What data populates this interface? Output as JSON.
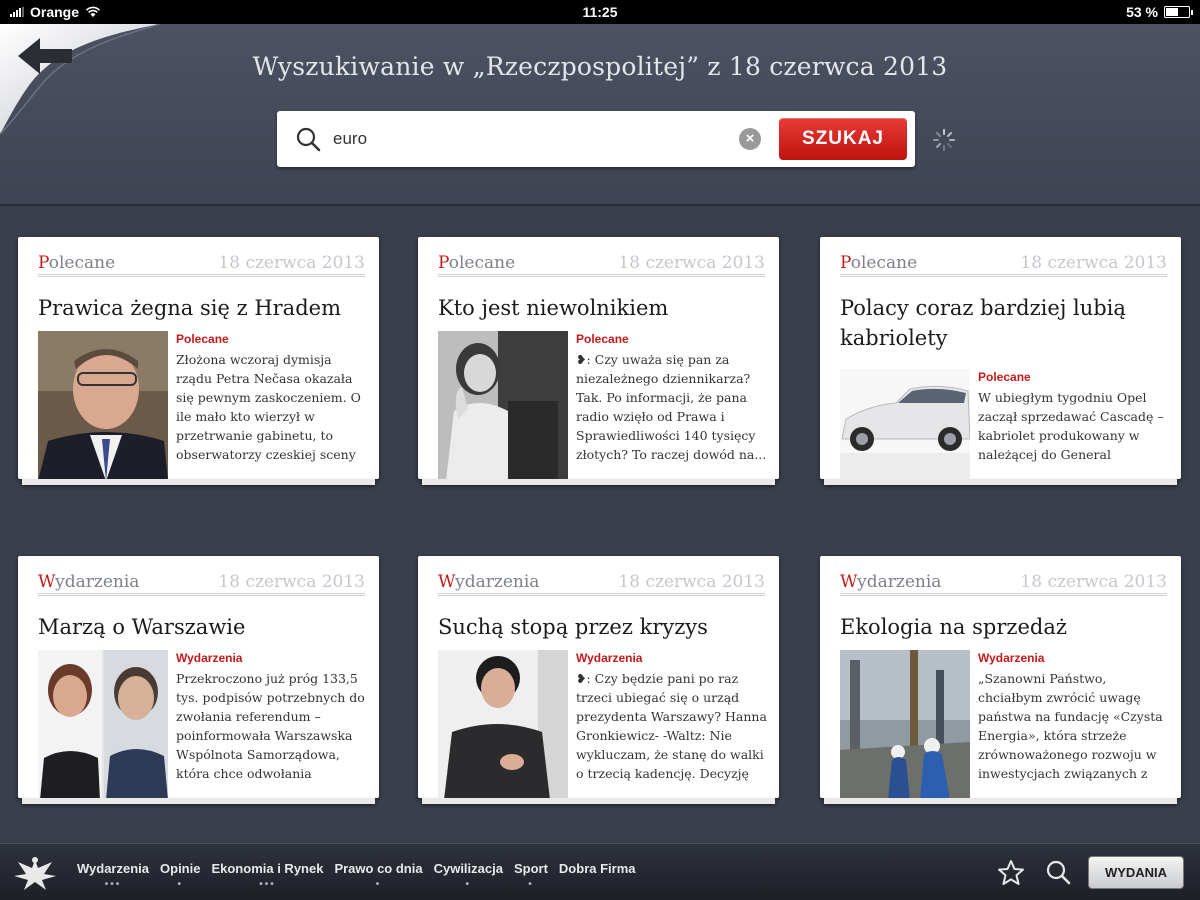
{
  "status_bar": {
    "carrier": "Orange",
    "time": "11:25",
    "battery": "53 %",
    "battery_level": 0.53
  },
  "header": {
    "title": "Wyszukiwanie w „Rzeczpospolitej” z 18 czerwca 2013",
    "back_icon": "back-arrow-icon"
  },
  "search": {
    "value": "euro",
    "button_label": "SZUKAJ"
  },
  "cards": [
    {
      "category": "Polecane",
      "date": "18 czerwca 2013",
      "title": "Prawica żegna się z Hradem",
      "tag": "Polecane",
      "excerpt": "Złożona wczoraj dymisja rządu Petra Nečasa okazała się pewnym zaskoczeniem. O ile mało kto wierzył w przetrwanie gabinetu, to obserwatorzy czeskiej sceny politycznej spod..."
    },
    {
      "category": "Polecane",
      "date": "18 czerwca 2013",
      "title": "Kto jest niewolnikiem",
      "tag": "Polecane",
      "excerpt": "❥: Czy uważa się pan za niezależnego dziennikarza? Tak. Po informacji, że pana radio wzięło od Prawa i Sprawiedliwości 140 tysięcy złotych? To raczej dowód na..."
    },
    {
      "category": "Polecane",
      "date": "18 czerwca 2013",
      "title": "Polacy coraz bardziej lubią kabriolety",
      "tag": "Polecane",
      "excerpt": "W ubiegłym tygodniu Opel zaczął sprzedawać Cascadę – kabriolet produkowany w należącej do General Motors..."
    },
    {
      "category": "Wydarzenia",
      "date": "18 czerwca 2013",
      "title": "Marzą o Warszawie",
      "tag": "Wydarzenia",
      "excerpt": "Przekroczono już próg 133,5 tys. podpisów potrzebnych do zwołania referendum – poinformowała Warszawska Wspólnota Samorządowa, która chce odwołania prezyde..."
    },
    {
      "category": "Wydarzenia",
      "date": "18 czerwca 2013",
      "title": "Suchą stopą przez kryzys",
      "tag": "Wydarzenia",
      "excerpt": "❥: Czy będzie pani po raz trzeci ubiegać się o urząd prezydenta Warszawy? Hanna Gronkiewicz- -Waltz: Nie wykluczam, że stanę do walki o trzecią kadencję. Decyzję podę..."
    },
    {
      "category": "Wydarzenia",
      "date": "18 czerwca 2013",
      "title": "Ekologia na sprzedaż",
      "tag": "Wydarzenia",
      "excerpt": "„Szanowni Państwo, chciałbym zwrócić uwagę państwa na fundację «Czysta Energia», która strzeże zrównoważonego rozwoju w inwestycjach związanych z eks..."
    }
  ],
  "bottom_nav": {
    "items": [
      {
        "label": "Wydarzenia",
        "dots": "•••"
      },
      {
        "label": "Opinie",
        "dots": "•"
      },
      {
        "label": "Ekonomia i Rynek",
        "dots": "•••"
      },
      {
        "label": "Prawo co dnia",
        "dots": "•"
      },
      {
        "label": "Cywilizacja",
        "dots": "•"
      },
      {
        "label": "Sport",
        "dots": "•"
      },
      {
        "label": "Dobra Firma",
        "dots": ""
      }
    ],
    "editions_label": "WYDANIA"
  },
  "colors": {
    "accent_red": "#c31a1a",
    "background": "#3a3f4c"
  }
}
